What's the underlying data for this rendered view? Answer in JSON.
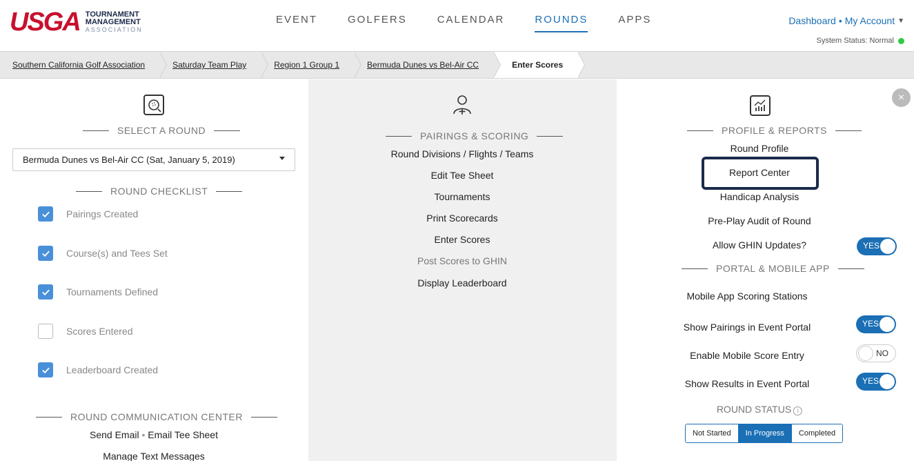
{
  "logo": {
    "brand": "USGA",
    "line1": "TOURNAMENT",
    "line2": "MANAGEMENT",
    "line3": "ASSOCIATION"
  },
  "nav": {
    "items": [
      "EVENT",
      "GOLFERS",
      "CALENDAR",
      "ROUNDS",
      "APPS"
    ],
    "active": "ROUNDS"
  },
  "account": {
    "dashboard": "Dashboard",
    "separator": "•",
    "my_account": "My Account",
    "system_status": "System Status: Normal"
  },
  "breadcrumb": [
    "Southern California Golf Association",
    "Saturday Team Play",
    "Region 1 Group 1",
    "Bermuda Dunes vs Bel-Air CC",
    "Enter Scores"
  ],
  "left": {
    "select_title": "SELECT A ROUND",
    "selected_round": "Bermuda Dunes vs Bel-Air CC (Sat, January 5, 2019)",
    "checklist_title": "ROUND CHECKLIST",
    "checklist": [
      {
        "label": "Pairings Created",
        "checked": true
      },
      {
        "label": "Course(s) and Tees Set",
        "checked": true
      },
      {
        "label": "Tournaments Defined",
        "checked": true
      },
      {
        "label": "Scores Entered",
        "checked": false
      },
      {
        "label": "Leaderboard Created",
        "checked": true
      }
    ],
    "comm_title": "ROUND COMMUNICATION CENTER",
    "send_email": "Send Email",
    "dot": "•",
    "email_tee_sheet": "Email Tee Sheet",
    "manage_text": "Manage Text Messages"
  },
  "middle": {
    "title": "PAIRINGS & SCORING",
    "links": [
      "Round Divisions / Flights / Teams",
      "Edit Tee Sheet",
      "Tournaments",
      "Print Scorecards",
      "Enter Scores",
      "Post Scores to GHIN",
      "Display Leaderboard"
    ]
  },
  "right": {
    "reports_title": "PROFILE & REPORTS",
    "round_profile": "Round Profile",
    "report_center": "Report Center",
    "handicap_analysis": "Handicap Analysis",
    "pre_play_audit": "Pre-Play Audit of Round",
    "allow_ghin": "Allow GHIN Updates?",
    "portal_title": "PORTAL & MOBILE APP",
    "mobile_stations": "Mobile App Scoring Stations",
    "show_pairings": "Show Pairings in Event Portal",
    "enable_mobile": "Enable Mobile Score Entry",
    "show_results": "Show Results in Event Portal",
    "yes": "YES",
    "no": "NO",
    "status_title": "ROUND STATUS",
    "status_options": [
      "Not Started",
      "In Progress",
      "Completed"
    ],
    "status_active": "In Progress",
    "close": "×",
    "info": "i"
  },
  "colors": {
    "accent": "#1b6fb5",
    "brand_red": "#c8102e",
    "checkbox": "#4a90d9",
    "status_ok": "#2ecc40"
  }
}
